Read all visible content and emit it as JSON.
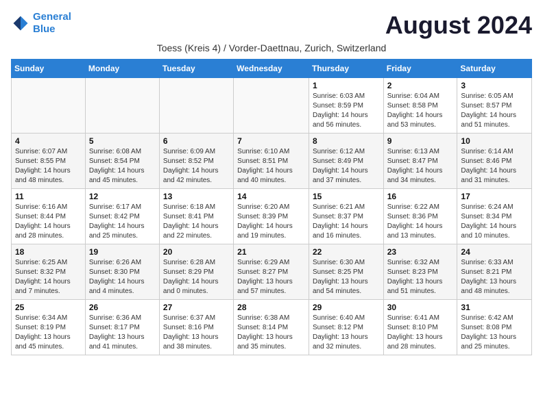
{
  "header": {
    "logo_line1": "General",
    "logo_line2": "Blue",
    "month_year": "August 2024",
    "subtitle": "Toess (Kreis 4) / Vorder-Daettnau, Zurich, Switzerland"
  },
  "weekdays": [
    "Sunday",
    "Monday",
    "Tuesday",
    "Wednesday",
    "Thursday",
    "Friday",
    "Saturday"
  ],
  "weeks": [
    [
      {
        "day": "",
        "info": ""
      },
      {
        "day": "",
        "info": ""
      },
      {
        "day": "",
        "info": ""
      },
      {
        "day": "",
        "info": ""
      },
      {
        "day": "1",
        "info": "Sunrise: 6:03 AM\nSunset: 8:59 PM\nDaylight: 14 hours\nand 56 minutes."
      },
      {
        "day": "2",
        "info": "Sunrise: 6:04 AM\nSunset: 8:58 PM\nDaylight: 14 hours\nand 53 minutes."
      },
      {
        "day": "3",
        "info": "Sunrise: 6:05 AM\nSunset: 8:57 PM\nDaylight: 14 hours\nand 51 minutes."
      }
    ],
    [
      {
        "day": "4",
        "info": "Sunrise: 6:07 AM\nSunset: 8:55 PM\nDaylight: 14 hours\nand 48 minutes."
      },
      {
        "day": "5",
        "info": "Sunrise: 6:08 AM\nSunset: 8:54 PM\nDaylight: 14 hours\nand 45 minutes."
      },
      {
        "day": "6",
        "info": "Sunrise: 6:09 AM\nSunset: 8:52 PM\nDaylight: 14 hours\nand 42 minutes."
      },
      {
        "day": "7",
        "info": "Sunrise: 6:10 AM\nSunset: 8:51 PM\nDaylight: 14 hours\nand 40 minutes."
      },
      {
        "day": "8",
        "info": "Sunrise: 6:12 AM\nSunset: 8:49 PM\nDaylight: 14 hours\nand 37 minutes."
      },
      {
        "day": "9",
        "info": "Sunrise: 6:13 AM\nSunset: 8:47 PM\nDaylight: 14 hours\nand 34 minutes."
      },
      {
        "day": "10",
        "info": "Sunrise: 6:14 AM\nSunset: 8:46 PM\nDaylight: 14 hours\nand 31 minutes."
      }
    ],
    [
      {
        "day": "11",
        "info": "Sunrise: 6:16 AM\nSunset: 8:44 PM\nDaylight: 14 hours\nand 28 minutes."
      },
      {
        "day": "12",
        "info": "Sunrise: 6:17 AM\nSunset: 8:42 PM\nDaylight: 14 hours\nand 25 minutes."
      },
      {
        "day": "13",
        "info": "Sunrise: 6:18 AM\nSunset: 8:41 PM\nDaylight: 14 hours\nand 22 minutes."
      },
      {
        "day": "14",
        "info": "Sunrise: 6:20 AM\nSunset: 8:39 PM\nDaylight: 14 hours\nand 19 minutes."
      },
      {
        "day": "15",
        "info": "Sunrise: 6:21 AM\nSunset: 8:37 PM\nDaylight: 14 hours\nand 16 minutes."
      },
      {
        "day": "16",
        "info": "Sunrise: 6:22 AM\nSunset: 8:36 PM\nDaylight: 14 hours\nand 13 minutes."
      },
      {
        "day": "17",
        "info": "Sunrise: 6:24 AM\nSunset: 8:34 PM\nDaylight: 14 hours\nand 10 minutes."
      }
    ],
    [
      {
        "day": "18",
        "info": "Sunrise: 6:25 AM\nSunset: 8:32 PM\nDaylight: 14 hours\nand 7 minutes."
      },
      {
        "day": "19",
        "info": "Sunrise: 6:26 AM\nSunset: 8:30 PM\nDaylight: 14 hours\nand 4 minutes."
      },
      {
        "day": "20",
        "info": "Sunrise: 6:28 AM\nSunset: 8:29 PM\nDaylight: 14 hours\nand 0 minutes."
      },
      {
        "day": "21",
        "info": "Sunrise: 6:29 AM\nSunset: 8:27 PM\nDaylight: 13 hours\nand 57 minutes."
      },
      {
        "day": "22",
        "info": "Sunrise: 6:30 AM\nSunset: 8:25 PM\nDaylight: 13 hours\nand 54 minutes."
      },
      {
        "day": "23",
        "info": "Sunrise: 6:32 AM\nSunset: 8:23 PM\nDaylight: 13 hours\nand 51 minutes."
      },
      {
        "day": "24",
        "info": "Sunrise: 6:33 AM\nSunset: 8:21 PM\nDaylight: 13 hours\nand 48 minutes."
      }
    ],
    [
      {
        "day": "25",
        "info": "Sunrise: 6:34 AM\nSunset: 8:19 PM\nDaylight: 13 hours\nand 45 minutes."
      },
      {
        "day": "26",
        "info": "Sunrise: 6:36 AM\nSunset: 8:17 PM\nDaylight: 13 hours\nand 41 minutes."
      },
      {
        "day": "27",
        "info": "Sunrise: 6:37 AM\nSunset: 8:16 PM\nDaylight: 13 hours\nand 38 minutes."
      },
      {
        "day": "28",
        "info": "Sunrise: 6:38 AM\nSunset: 8:14 PM\nDaylight: 13 hours\nand 35 minutes."
      },
      {
        "day": "29",
        "info": "Sunrise: 6:40 AM\nSunset: 8:12 PM\nDaylight: 13 hours\nand 32 minutes."
      },
      {
        "day": "30",
        "info": "Sunrise: 6:41 AM\nSunset: 8:10 PM\nDaylight: 13 hours\nand 28 minutes."
      },
      {
        "day": "31",
        "info": "Sunrise: 6:42 AM\nSunset: 8:08 PM\nDaylight: 13 hours\nand 25 minutes."
      }
    ]
  ]
}
